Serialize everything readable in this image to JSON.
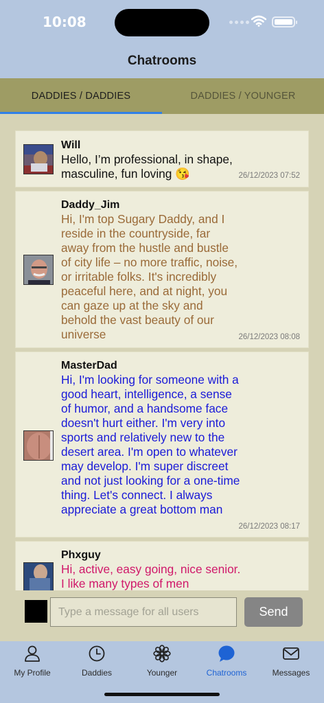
{
  "status": {
    "time": "10:08"
  },
  "header": {
    "title": "Chatrooms"
  },
  "top_tabs": [
    {
      "label": "DADDIES / DADDIES",
      "selected": true
    },
    {
      "label": "DADDIES / YOUNGER",
      "selected": false
    }
  ],
  "colors": {
    "tab_indicator": "#2f80e8",
    "message_daddy_jim": "#9a6a38",
    "message_masterdad": "#1a1ad8",
    "message_phxguy": "#d0186a",
    "message_will": "#111111"
  },
  "messages": [
    {
      "sender": "Will",
      "text": "Hello, I’m professional, in shape, masculine, fun loving 😘",
      "timestamp": "26/12/2023 07:52",
      "avatar": "photo-avatar"
    },
    {
      "sender": "Daddy_Jim",
      "text": "Hi, I'm top Sugary Daddy, and I reside in the countryside, far away from the hustle and bustle of city life – no more traffic, noise, or irritable folks. It's incredibly peaceful here, and at night, you can gaze up at the sky and behold the vast beauty of our universe",
      "timestamp": "26/12/2023 08:08",
      "avatar": "photo-avatar"
    },
    {
      "sender": "MasterDad",
      "text": "Hi, I'm looking for someone with a good heart, intelligence, a sense of humor, and a handsome face doesn't hurt either. I'm very into sports and relatively new to the desert area. I'm open to whatever may develop. I'm super discreet and not just looking for a one-time thing. Let's connect. I always appreciate a great bottom man",
      "timestamp": "26/12/2023 08:17",
      "avatar": "photo-avatar"
    },
    {
      "sender": "Phxguy",
      "text": "Hi, active, easy going, nice senior. I like many types of men",
      "timestamp": "",
      "avatar": "photo-avatar"
    }
  ],
  "composer": {
    "placeholder": "Type a message for all users",
    "value": "",
    "send_label": "Send"
  },
  "bottom_tabs": [
    {
      "label": "My Profile",
      "icon": "person-icon",
      "active": false
    },
    {
      "label": "Daddies",
      "icon": "clock-icon",
      "active": false
    },
    {
      "label": "Younger",
      "icon": "flower-icon",
      "active": false
    },
    {
      "label": "Chatrooms",
      "icon": "chat-bubble-icon",
      "active": true
    },
    {
      "label": "Messages",
      "icon": "envelope-icon",
      "active": false
    }
  ]
}
